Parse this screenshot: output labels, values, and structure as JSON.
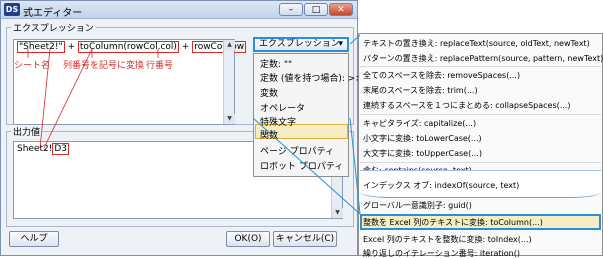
{
  "window": {
    "title": "式エディター",
    "app_icon": "DS",
    "controls": {
      "minimize": "–",
      "maximize": "□",
      "close": "✕"
    }
  },
  "expression": {
    "group_label": "エクスプレッション",
    "dropdown_label": "エクスプレッション",
    "tokens": [
      "\"Sheet2!\"",
      " + ",
      "toColumn(rowCol.col)",
      " + ",
      "rowCol.row"
    ],
    "notes": {
      "sheet": "シート名",
      "col": "列番号を記号に変換",
      "row": "行番号"
    }
  },
  "menu1": {
    "items": [
      "定数: \"\"",
      "定数 (値を持つ場合): >> <<",
      "変数",
      "オペレータ",
      "特殊文字",
      "関数",
      "ページ プロパティ",
      "ロボット プロパティ"
    ],
    "selected": "関数"
  },
  "output": {
    "group_label": "出力値",
    "value_prefix": "Sheet2!",
    "value_cell": "D3"
  },
  "buttons": {
    "help": "ヘルプ",
    "ok": "OK(O)",
    "cancel": "キャンセル(C)"
  },
  "menu2": {
    "items": [
      "テキストの置き換え: replaceText(source, oldText, newText)",
      "パターンの置き換え: replacePattern(source, pattern, newText)",
      "全てのスペースを除去: removeSpaces(...)",
      "末尾のスペースを除去: trim(...)",
      "連続するスペースを１つにまとめる: collapseSpaces(...)",
      "キャピタライズ: capitalize(...)",
      "小文字に変換: toLowerCase(...)",
      "大文字に変換: toUpperCase(...)",
      "含む: contains(source, text)",
      "インデックス オブ: indexOf(source, text)",
      "グローバル一意識別子: guid()",
      "整数を Excel 列のテキストに変換: toColumn(...)",
      "Excel 列のテキストを整数に変換: toIndex(...)",
      "繰り返しのイテレーション番号: iteration()"
    ],
    "selected": "整数を Excel 列のテキストに変換: toColumn(...)"
  }
}
